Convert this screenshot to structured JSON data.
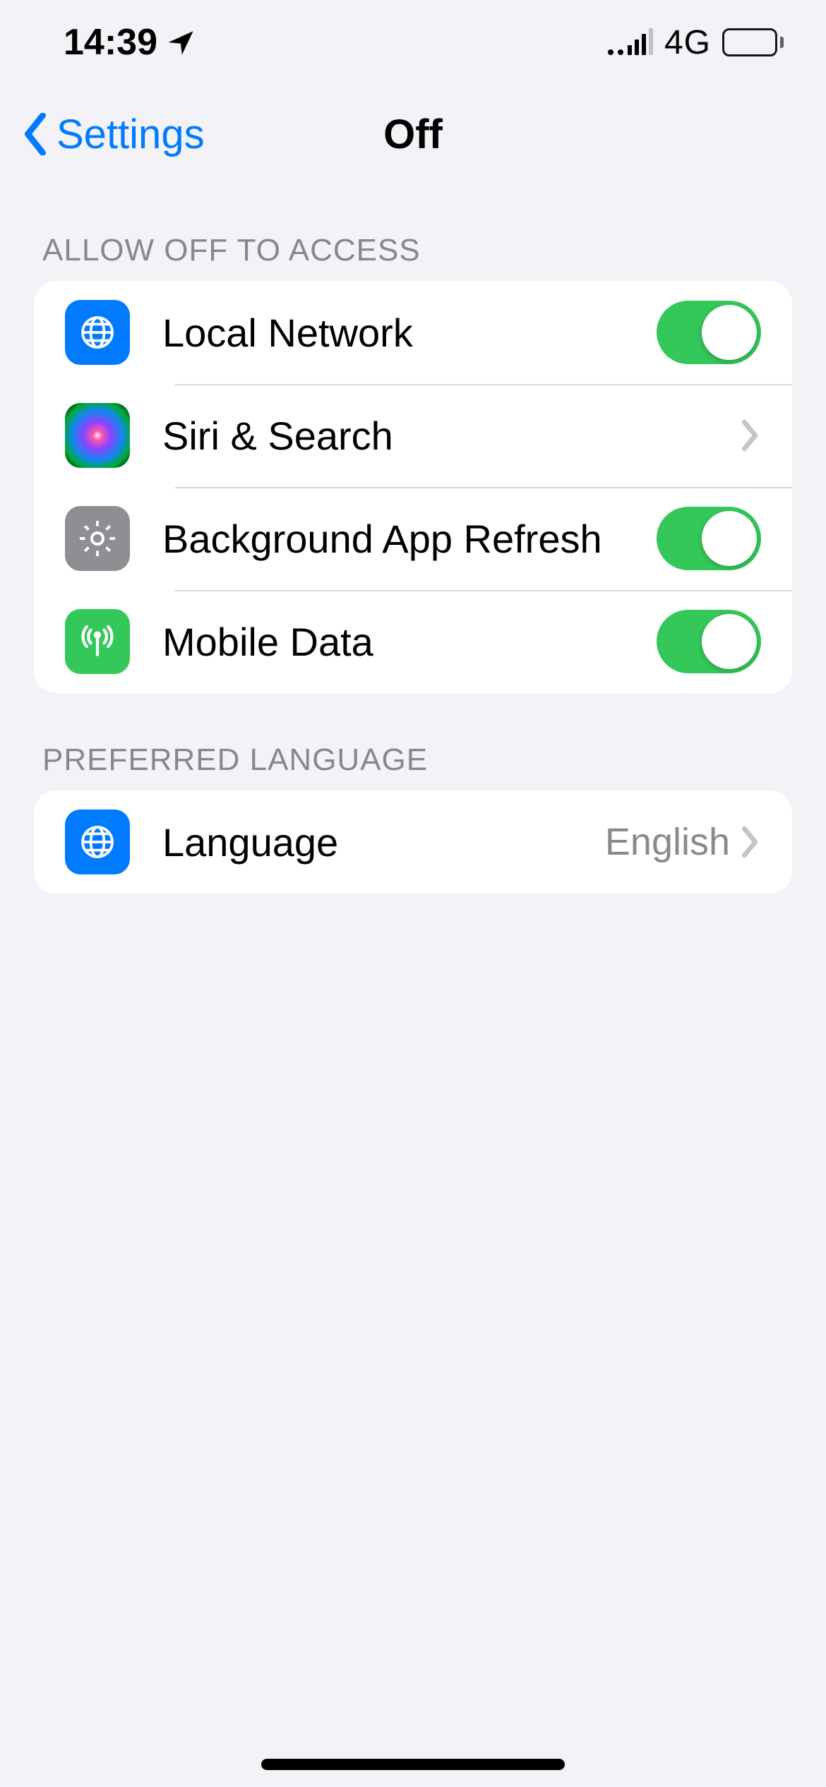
{
  "status": {
    "time": "14:39",
    "network_label": "4G"
  },
  "nav": {
    "back_label": "Settings",
    "title": "Off"
  },
  "sections": {
    "access": {
      "header": "ALLOW OFF TO ACCESS",
      "rows": {
        "local_network": {
          "label": "Local Network",
          "on": true
        },
        "siri_search": {
          "label": "Siri & Search"
        },
        "bg_refresh": {
          "label": "Background App Refresh",
          "on": true
        },
        "mobile_data": {
          "label": "Mobile Data",
          "on": true
        }
      }
    },
    "language": {
      "header": "PREFERRED LANGUAGE",
      "rows": {
        "language": {
          "label": "Language",
          "value": "English"
        }
      }
    }
  }
}
